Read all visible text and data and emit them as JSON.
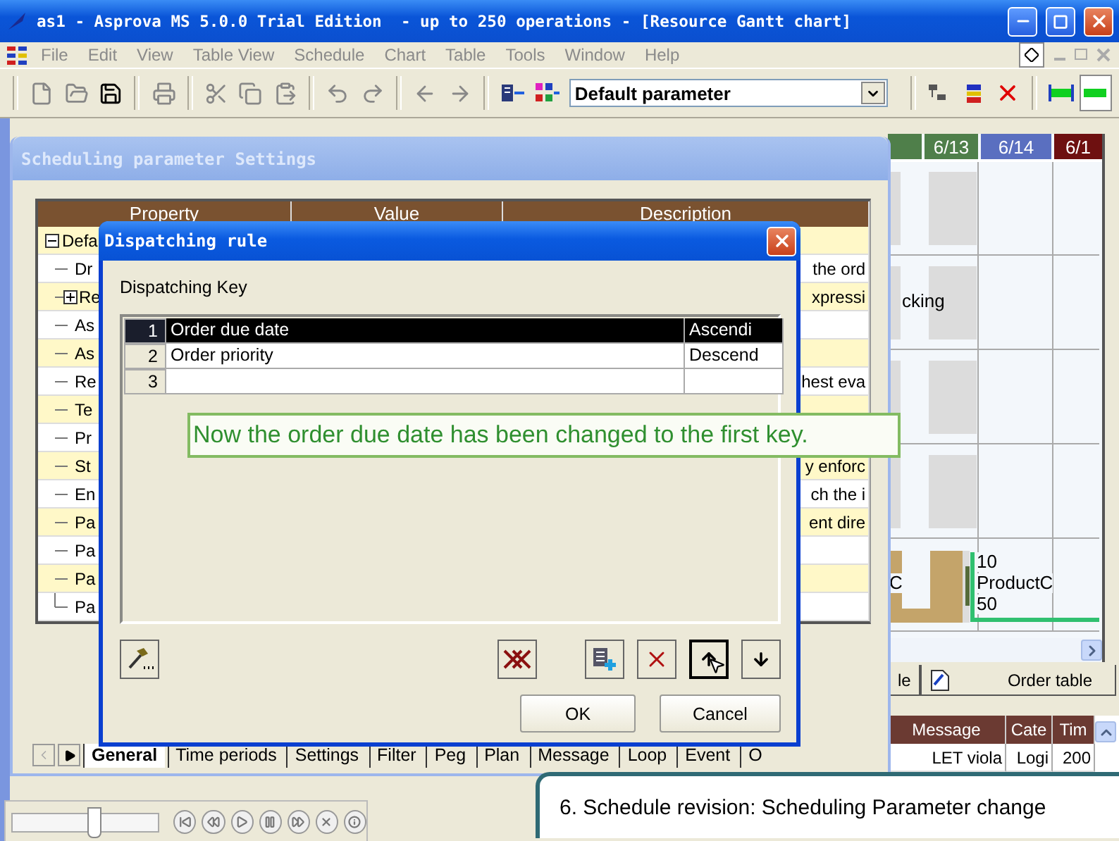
{
  "window": {
    "title": "as1 - Asprova MS 5.0.0 Trial Edition  - up to 250 operations - [Resource Gantt chart]"
  },
  "menu": [
    "File",
    "Edit",
    "View",
    "Table View",
    "Schedule",
    "Chart",
    "Table",
    "Tools",
    "Window",
    "Help"
  ],
  "toolbar": {
    "parameter_combo": {
      "value": "Default parameter"
    }
  },
  "gantt": {
    "dates": [
      {
        "label": "6/13",
        "color": "#4f7f4a"
      },
      {
        "label": "6/14",
        "color": "#5a6fc0"
      },
      {
        "label": "6/1",
        "color": "#6e1010"
      }
    ],
    "row_text": "cking",
    "bar_left_label": "C",
    "bar_labels": [
      "10",
      "ProductC",
      "50"
    ]
  },
  "view_tabs": [
    {
      "label": "le",
      "selected": false
    },
    {
      "label": "Order table",
      "selected": false
    }
  ],
  "messages": {
    "columns": [
      "Message",
      "Cate",
      "Tim"
    ],
    "rows": [
      [
        "LET viola",
        "Logi",
        "200"
      ]
    ]
  },
  "settings": {
    "title": "Scheduling parameter Settings",
    "columns": [
      "Property",
      "Value",
      "Description"
    ],
    "rows": [
      {
        "property": "Defa",
        "description": "",
        "kind": "open"
      },
      {
        "property": "Dr",
        "description": "the ord",
        "kind": "leaf"
      },
      {
        "property": "Re",
        "description": "xpressi",
        "kind": "closed"
      },
      {
        "property": "As",
        "description": "",
        "kind": "leaf"
      },
      {
        "property": "As",
        "description": "",
        "kind": "leaf"
      },
      {
        "property": "Re",
        "description": "hest eva",
        "kind": "leaf"
      },
      {
        "property": "Te",
        "description": "",
        "kind": "leaf"
      },
      {
        "property": "Pr",
        "description": "",
        "kind": "leaf"
      },
      {
        "property": "St",
        "description": "y enforc",
        "kind": "leaf"
      },
      {
        "property": "En",
        "description": "ch the i",
        "kind": "leaf"
      },
      {
        "property": "Pa",
        "description": "ent dire",
        "kind": "leaf"
      },
      {
        "property": "Pa",
        "description": "",
        "kind": "leaf"
      },
      {
        "property": "Pa",
        "description": "",
        "kind": "leaf"
      },
      {
        "property": "Pa",
        "description": "",
        "kind": "leaf"
      }
    ],
    "tabs": [
      {
        "label": "General",
        "selected": true
      },
      {
        "label": "Time periods",
        "selected": false
      },
      {
        "label": "Settings",
        "selected": false
      },
      {
        "label": "Filter",
        "selected": false
      },
      {
        "label": "Peg",
        "selected": false
      },
      {
        "label": "Plan",
        "selected": false
      },
      {
        "label": "Message",
        "selected": false
      },
      {
        "label": "Loop",
        "selected": false
      },
      {
        "label": "Event",
        "selected": false
      },
      {
        "label": "O",
        "selected": false
      }
    ]
  },
  "dispatch": {
    "title": "Dispatching rule",
    "label": "Dispatching Key",
    "rows": [
      {
        "index": "1",
        "key": "Order due date",
        "order": "Ascendi",
        "selected": true
      },
      {
        "index": "2",
        "key": "Order priority",
        "order": "Descend",
        "selected": false
      },
      {
        "index": "3",
        "key": "",
        "order": "",
        "selected": false
      }
    ],
    "buttons": [
      "OK",
      "Cancel"
    ]
  },
  "annotation": "Now the order due date has been changed to the first key.",
  "caption": "6. Schedule revision: Scheduling Parameter change",
  "player": {
    "level": 0.55
  }
}
